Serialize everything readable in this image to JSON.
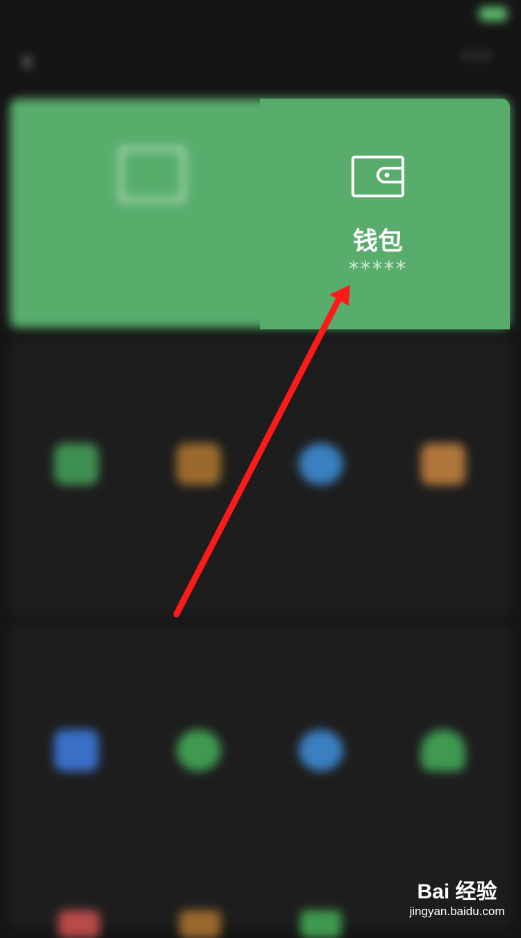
{
  "status_bar": {
    "carrier": "",
    "time": "",
    "battery": ""
  },
  "nav": {
    "title": "",
    "back_icon": "back-arrow-icon",
    "more_icon": "more-icon"
  },
  "card": {
    "left_label": "",
    "wallet_label": "钱包",
    "wallet_balance": "*****",
    "color": "#58ad6d"
  },
  "sections": [
    {
      "title": "",
      "items": [
        {
          "label": "",
          "color": "#3f8f52"
        },
        {
          "label": "",
          "color": "#9a6a2c"
        },
        {
          "label": "",
          "color": "#3a7fc0"
        },
        {
          "label": "",
          "color": "#b0763a"
        }
      ]
    },
    {
      "title": "",
      "items": [
        {
          "label": "",
          "color": "#3a6fc8"
        },
        {
          "label": "",
          "color": "#3f9a50"
        },
        {
          "label": "",
          "color": "#3a7fc0"
        },
        {
          "label": "",
          "color": "#3f9a50"
        }
      ]
    }
  ],
  "annotation": {
    "color": "#ff1a1a"
  },
  "watermark": {
    "logo": "Bai  经验",
    "url": "jingyan.baidu.com"
  }
}
